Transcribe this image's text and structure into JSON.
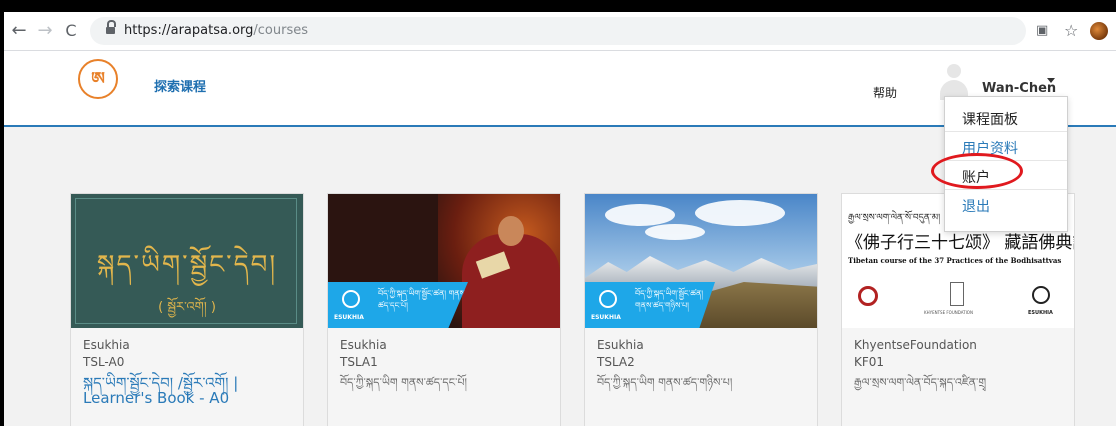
{
  "browser": {
    "url_host": "https://arapatsa.org",
    "url_path": "/courses",
    "icons": [
      "back-arrow-icon",
      "forward-arrow-icon",
      "reload-icon",
      "lock-icon",
      "translate-icon",
      "star-icon",
      "profile-icon"
    ]
  },
  "header": {
    "logo_glyph": "ཨ",
    "nav_link": "探索课程",
    "help": "帮助",
    "username": "Wan-Chen"
  },
  "dropdown": {
    "items": [
      "课程面板",
      "用户资料",
      "账户",
      "退出"
    ]
  },
  "colors": {
    "accent": "#2a7ab8",
    "logo": "#e8812a",
    "highlight": "#e0191e",
    "band": "#1ea7e8"
  },
  "courses": [
    {
      "org": "Esukhia",
      "code": "TSL-A0",
      "title": "སྐད་ཡིག་སྦྱོང་དེབ། /སྦྱོར་འགོ། | Learner's Book - A0",
      "image_text": "སྐད་ཡིག་སྦྱོང་དེབ།",
      "image_sub": "( སྦྱོར་འགོ། )"
    },
    {
      "org": "Esukhia",
      "code": "TSLA1",
      "title": "བོད་ཀྱི་སྐད་ཡིག གནས་ཚད་དང་པོ།",
      "image_text": "བོད་ཀྱི་སྐད་ཡིག་སྦྱོང་ཚན། གནས་ཚད་དང་པོ།",
      "image_brand": "ESUKHIA"
    },
    {
      "org": "Esukhia",
      "code": "TSLA2",
      "title": "བོད་ཀྱི་སྐད་ཡིག གནས་ཚད་གཉིས་པ།",
      "image_text": "བོད་ཀྱི་སྐད་ཡིག་སྦྱོང་ཚན། གནས་ཚད་གཉིས་པ།",
      "image_brand": "ESUKHIA"
    },
    {
      "org": "KhyentseFoundation",
      "code": "KF01",
      "title": "རྒྱལ་སྲས་ལག་ལེན་བོད་སྐད་འཛིན་གྲྭ",
      "image_tib": "རྒྱལ་སྲས་ལག་ལེན་སོ་བདུན་མ།",
      "image_cn": "《佛子行三十七颂》 藏語佛典課",
      "image_en": "Tibetan course of the 37 Practices of the Bodhisattvas",
      "image_caption_left": "",
      "image_caption_mid": "KHYENTSE FOUNDATION",
      "image_brand": "ESUKHIA"
    }
  ]
}
